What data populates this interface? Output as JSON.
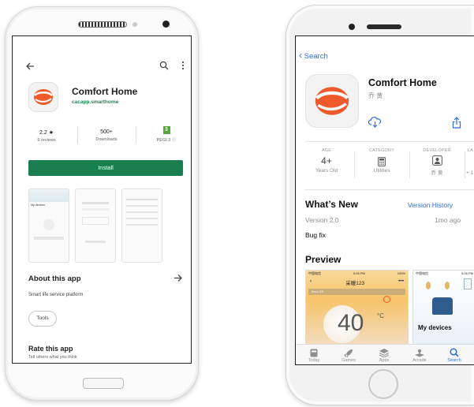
{
  "android": {
    "app_name": "Comfort Home",
    "developer": "cacapp.smarthome",
    "stats": [
      {
        "value": "2.2 ★",
        "label": "9 reviews"
      },
      {
        "value": "500+",
        "label": "Downloads"
      },
      {
        "value": "3",
        "label": "PEGI 3 ⓘ"
      }
    ],
    "install_label": "Install",
    "screenshot_text": "My devices",
    "about_title": "About this app",
    "about_text": "Smart life service platform",
    "tag": "Tools",
    "rate_title": "Rate this app",
    "rate_sub": "Tell others what you think"
  },
  "ios": {
    "back_label": "Search",
    "app_name": "Comfort Home",
    "developer": "乔 黄",
    "meta": [
      {
        "header": "AGE",
        "value": "4+",
        "sub": "Years Old"
      },
      {
        "header": "CATEGORY",
        "value": "",
        "sub": "Utilities"
      },
      {
        "header": "DEVELOPER",
        "value": "",
        "sub": "乔 黄"
      },
      {
        "header": "LA",
        "value": "",
        "sub": "+ 1"
      }
    ],
    "whats_new": "What’s New",
    "version_history": "Version History",
    "version": "Version 2.0",
    "ago": "1mo ago",
    "notes": "Bug fix",
    "preview": "Preview",
    "preview1": {
      "carrier": "中国电信",
      "time": "5:26 PM",
      "battery": "100%",
      "room": "采暖123",
      "temp": "40",
      "unit": "°C",
      "status": "Error 53"
    },
    "preview2": {
      "carrier": "中国电信",
      "time": "5:26 PM",
      "label": "My devices"
    },
    "tabs": [
      "Today",
      "Games",
      "Apps",
      "Arcade",
      "Search"
    ],
    "accent": "#2d6fd8"
  },
  "brand": {
    "orange": "#ef5a2a",
    "green": "#1a7f50"
  }
}
